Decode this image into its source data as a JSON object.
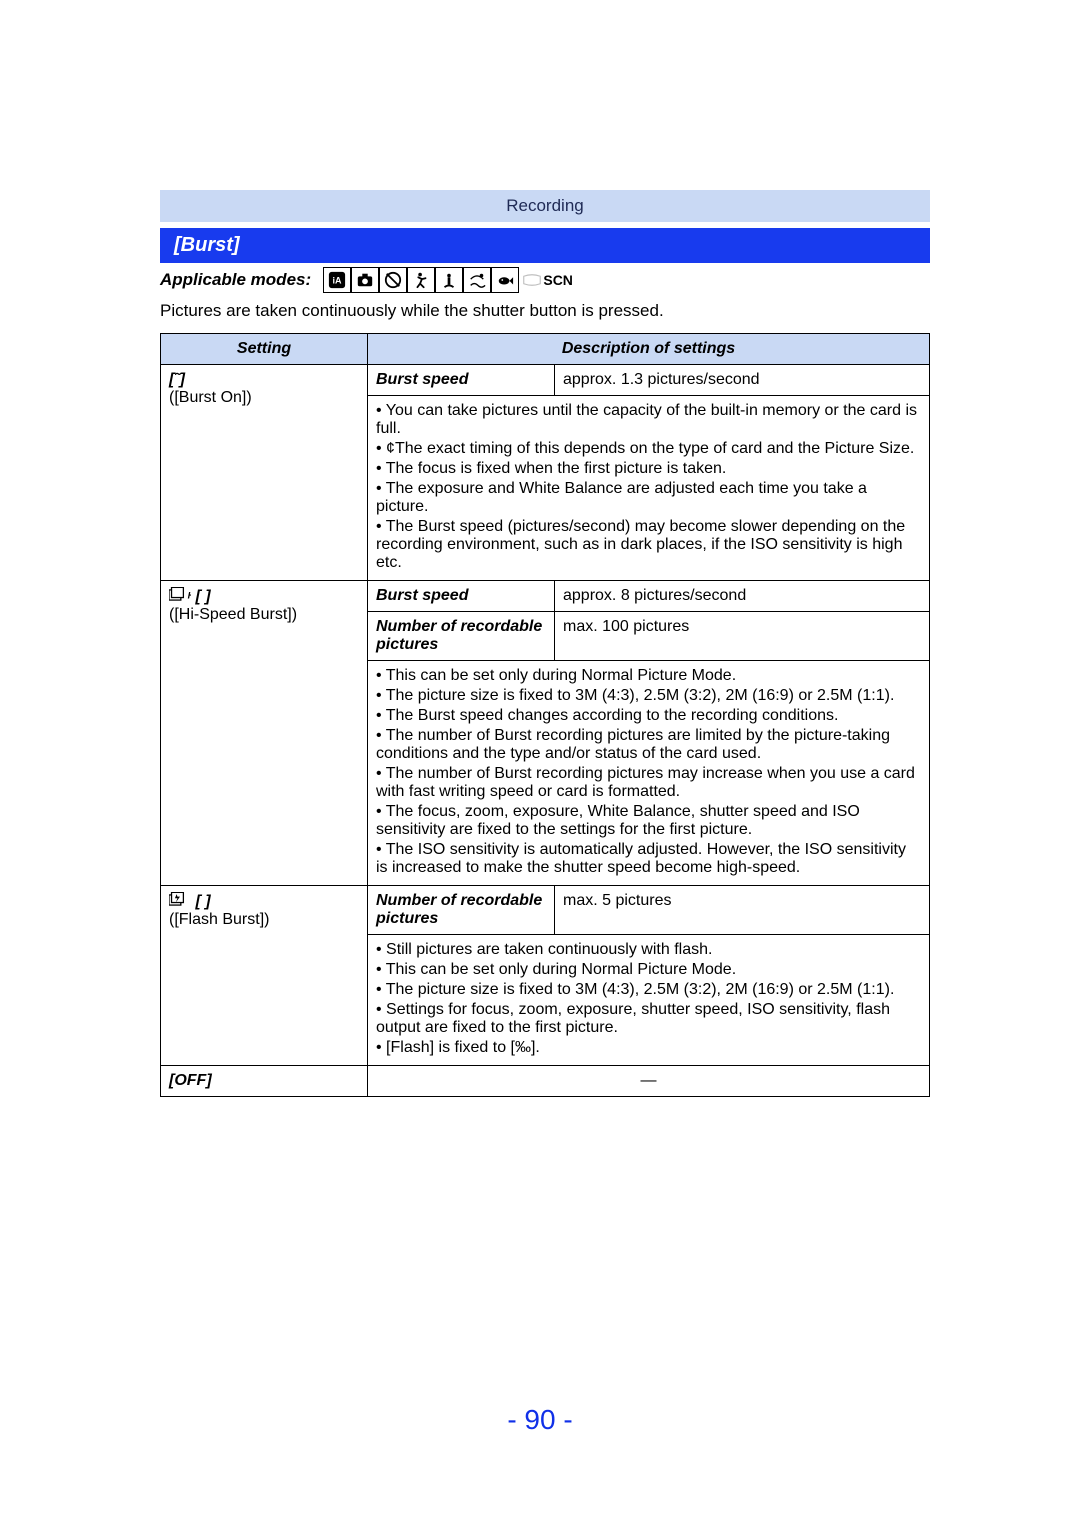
{
  "header": {
    "section": "Recording",
    "title": "[Burst]"
  },
  "modes": {
    "label": "Applicable modes:",
    "items": [
      {
        "name": "intelligent-auto-icon",
        "on": true,
        "glyph": "iA"
      },
      {
        "name": "normal-picture-icon",
        "on": true,
        "glyph": "camera"
      },
      {
        "name": "creative-control-icon",
        "on": true,
        "glyph": "palette"
      },
      {
        "name": "sports-icon",
        "on": true,
        "glyph": "runner"
      },
      {
        "name": "snow-icon",
        "on": true,
        "glyph": "snow"
      },
      {
        "name": "beach-icon",
        "on": true,
        "glyph": "beach"
      },
      {
        "name": "underwater-icon",
        "on": true,
        "glyph": "fish"
      },
      {
        "name": "panorama-icon",
        "on": false,
        "glyph": "pano"
      },
      {
        "name": "scene-mode-icon",
        "on": true,
        "glyph": "SCN"
      }
    ]
  },
  "intro": "Pictures are taken continuously while the shutter button is pressed.",
  "table": {
    "head": {
      "setting": "Setting",
      "desc": "Description of settings"
    },
    "rows": {
      "burst_on": {
        "icon_label": "[˜]",
        "sub": "([Burst On])",
        "speed_label": "Burst speed",
        "speed_value": "approx. 1.3 pictures/second",
        "notes": [
          "• You can take pictures until the capacity of the built-in memory or the card is full.",
          "• ¢The exact timing of this depends on the type of card and the Picture Size.",
          "• The focus is fixed when the first picture is taken.",
          "• The exposure and White Balance are adjusted each time you take a picture.",
          "• The Burst speed (pictures/second) may become slower depending on the recording environment, such as in dark places, if the ISO sensitivity is high etc."
        ]
      },
      "hi_speed": {
        "icon_label": "[  ]",
        "sub": "([Hi-Speed Burst])",
        "speed_label": "Burst speed",
        "speed_value": "approx. 8 pictures/second",
        "count_label": "Number of recordable pictures",
        "count_value": "max. 100 pictures",
        "notes": [
          "• This can be set only during Normal Picture Mode.",
          "• The picture size is fixed to 3M (4:3), 2.5M (3:2), 2M (16:9) or 2.5M (1:1).",
          "• The Burst speed changes according to the recording conditions.",
          "• The number of Burst recording pictures are limited by the picture-taking conditions and the type and/or status of the card used.",
          "• The number of Burst recording pictures may increase when you use a card with fast writing speed or card is formatted.",
          "• The focus, zoom, exposure, White Balance, shutter speed and ISO sensitivity are fixed to the settings for the first picture.",
          "• The ISO sensitivity is automatically adjusted. However, the ISO sensitivity is increased to make the shutter speed become high-speed."
        ]
      },
      "flash_burst": {
        "icon_label": "[  ]",
        "sub": "([Flash Burst])",
        "count_label": "Number of recordable pictures",
        "count_value": "max. 5 pictures",
        "notes": [
          "• Still pictures are taken continuously with flash.",
          "• This can be set only during Normal Picture Mode.",
          "• The picture size is fixed to 3M (4:3), 2.5M (3:2), 2M (16:9) or 2.5M (1:1).",
          "• Settings for focus, zoom, exposure, shutter speed, ISO sensitivity, flash output are fixed to the first picture.",
          "• [Flash] is fixed to [‰]."
        ]
      },
      "off": {
        "label": "[OFF]",
        "value": "—"
      }
    }
  },
  "pagenum": "- 90 -"
}
